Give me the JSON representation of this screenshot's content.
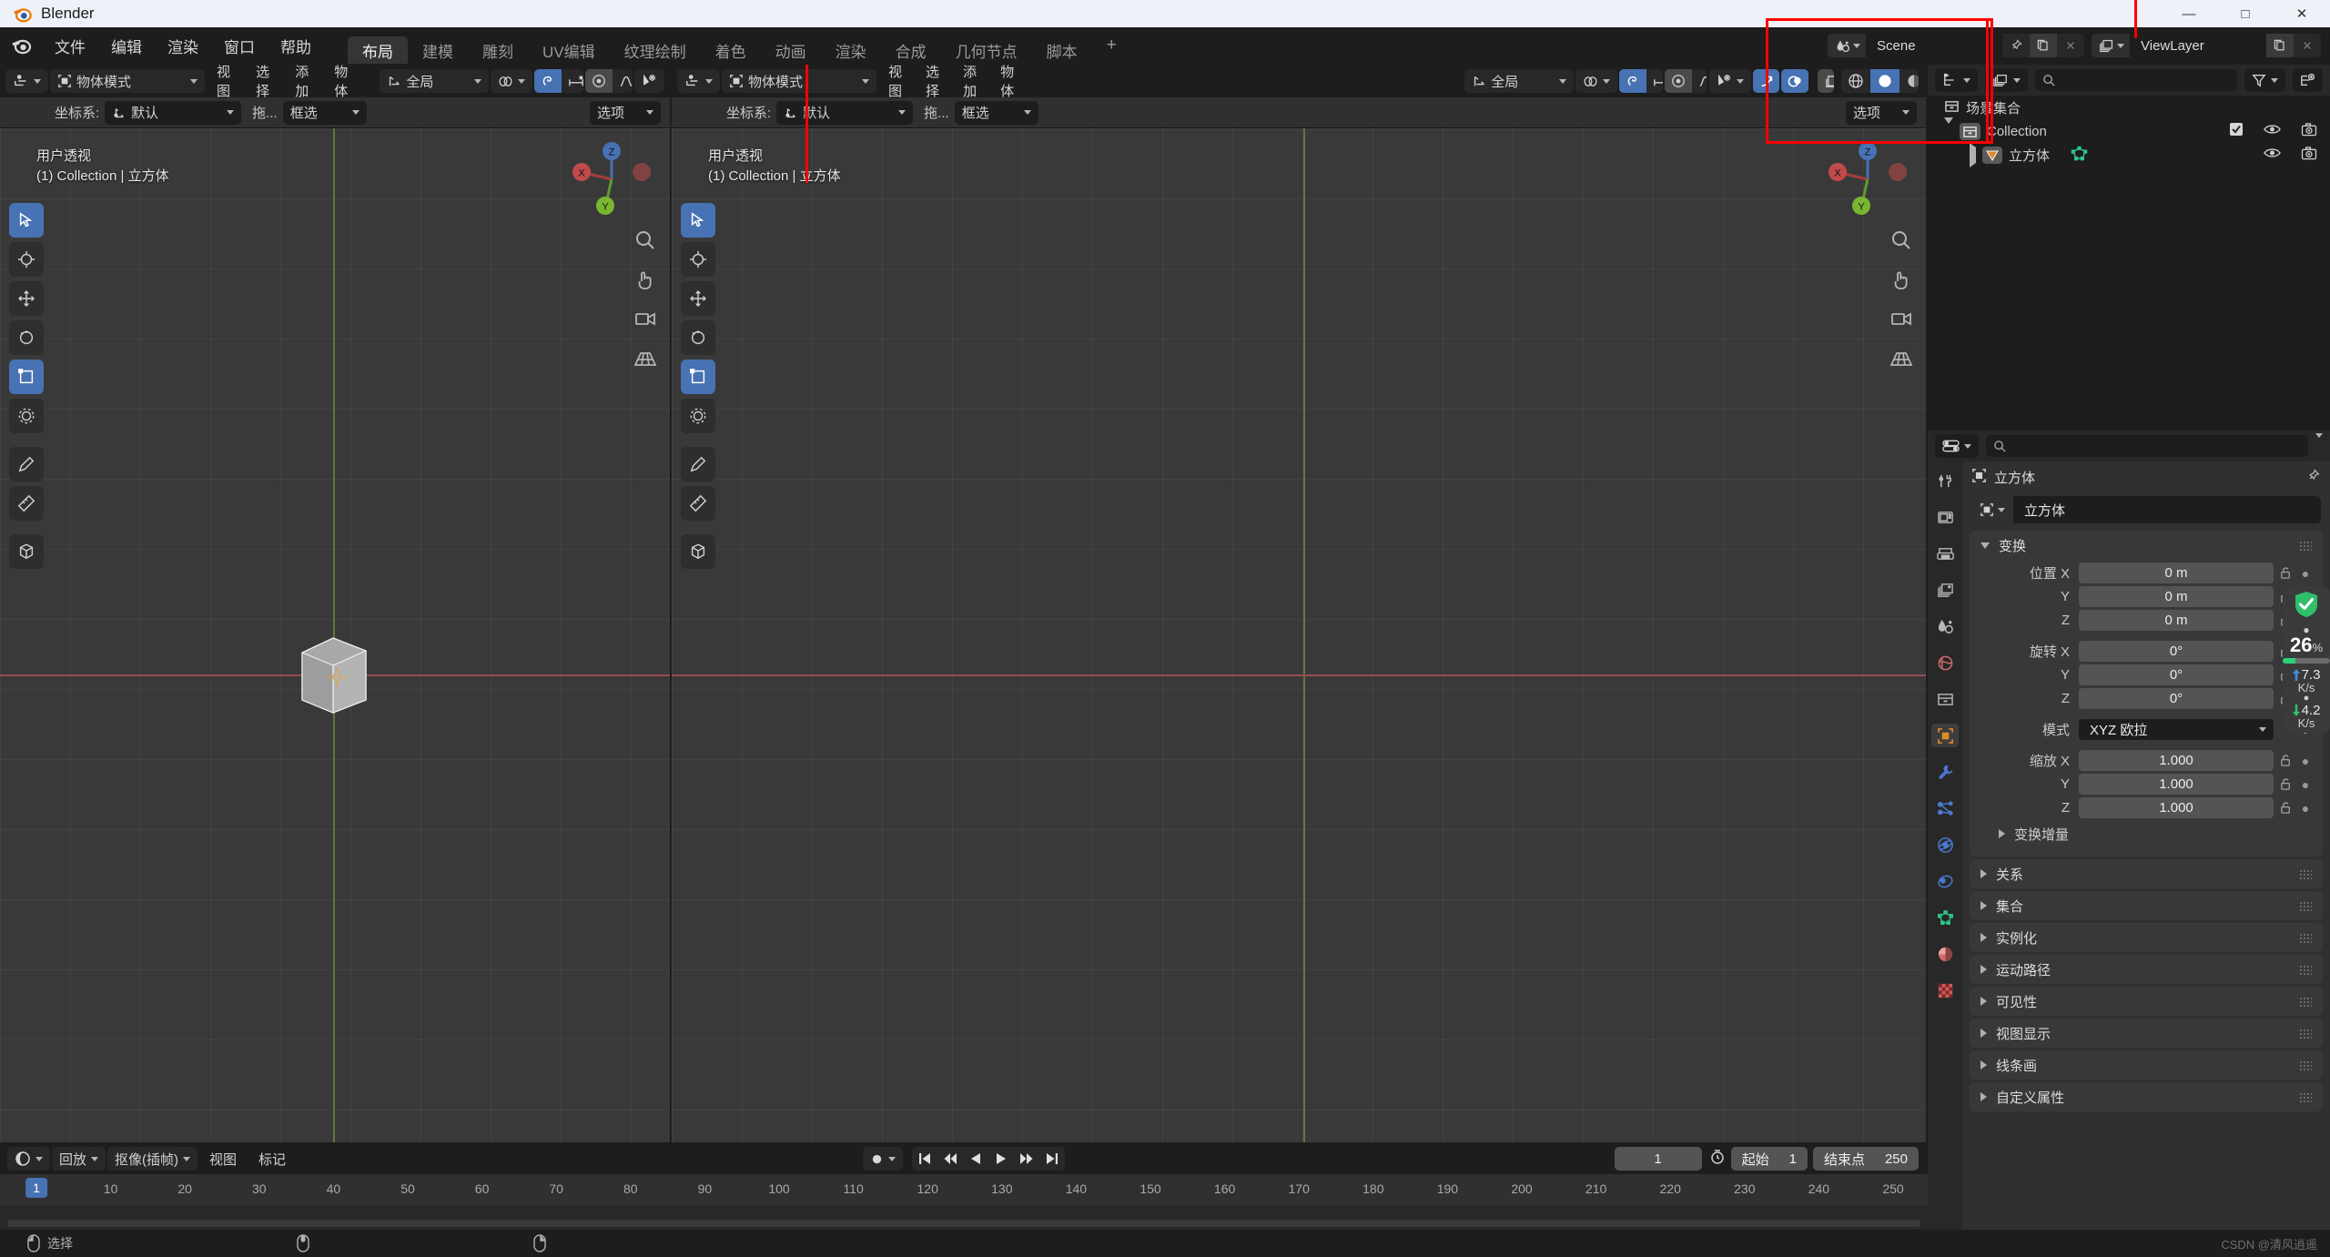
{
  "window": {
    "title": "Blender",
    "minimize": "—",
    "maximize": "□",
    "close": "✕"
  },
  "topbar": {
    "menus": [
      "文件",
      "编辑",
      "渲染",
      "窗口",
      "帮助"
    ],
    "workspaces": [
      {
        "label": "布局",
        "active": true
      },
      {
        "label": "建模",
        "active": false
      },
      {
        "label": "雕刻",
        "active": false
      },
      {
        "label": "UV编辑",
        "active": false
      },
      {
        "label": "纹理绘制",
        "active": false
      },
      {
        "label": "着色",
        "active": false
      },
      {
        "label": "动画",
        "active": false
      },
      {
        "label": "渲染",
        "active": false
      },
      {
        "label": "合成",
        "active": false
      },
      {
        "label": "几何节点",
        "active": false
      },
      {
        "label": "脚本",
        "active": false
      }
    ],
    "add_workspace": "+",
    "scene_name": "Scene",
    "viewlayer_name": "ViewLayer"
  },
  "viewport": {
    "mode": "物体模式",
    "menus": [
      "视图",
      "选择",
      "添加",
      "物体"
    ],
    "transform_orientation": "全局",
    "tool_settings": {
      "coord_label": "坐标系:",
      "coord_value": "默认",
      "drag_label": "拖...",
      "drag_value": "框选",
      "options_label": "选项"
    },
    "overlay_line1": "用户透视",
    "overlay_line2": "(1) Collection | 立方体",
    "gizmo_axes": {
      "x": "X",
      "y": "Y",
      "z": "Z"
    }
  },
  "outliner": {
    "display_mode_icon": "outliner-icon",
    "filter_icon": "filter-icon",
    "rows": [
      {
        "label": "场景集合",
        "indent": 0,
        "icon": "collection-icon",
        "has_disclosure": false,
        "checkbox": false,
        "eye": false,
        "camera": false
      },
      {
        "label": "Collection",
        "indent": 1,
        "icon": "collection-icon",
        "has_disclosure": true,
        "expanded": true,
        "checkbox": true,
        "eye": true,
        "camera": true
      },
      {
        "label": "立方体",
        "indent": 2,
        "icon": "mesh-object-icon",
        "has_disclosure": true,
        "expanded": false,
        "checkbox": false,
        "eye": true,
        "camera": true,
        "data_icon": "mesh-data-icon"
      }
    ]
  },
  "properties": {
    "breadcrumb_object": "立方体",
    "id_name": "立方体",
    "transform_panel": {
      "title": "变换",
      "location_label": "位置 X",
      "location": [
        "0 m",
        "0 m",
        "0 m"
      ],
      "rotation_label": "旋转 X",
      "rotation": [
        "0°",
        "0°",
        "0°"
      ],
      "mode_label": "模式",
      "mode_value": "XYZ 欧拉",
      "scale_label": "缩放 X",
      "scale": [
        "1.000",
        "1.000",
        "1.000"
      ],
      "axis_y": "Y",
      "axis_z": "Z",
      "delta_label": "变换增量"
    },
    "collapsed_panels": [
      "关系",
      "集合",
      "实例化",
      "运动路径",
      "可见性",
      "视图显示",
      "线条画",
      "自定义属性"
    ],
    "tabs": [
      {
        "name": "tool-tab",
        "color": "#b9b9b9",
        "active": false
      },
      {
        "name": "render-tab",
        "color": "#b9b9b9",
        "active": false
      },
      {
        "name": "output-tab",
        "color": "#b9b9b9",
        "active": false
      },
      {
        "name": "view-layer-tab",
        "color": "#b9b9b9",
        "active": false
      },
      {
        "name": "scene-tab",
        "color": "#b9b9b9",
        "active": false
      },
      {
        "name": "world-tab",
        "color": "#d06a6a",
        "active": false
      },
      {
        "name": "collection-tab",
        "color": "#b9b9b9",
        "active": false
      },
      {
        "name": "object-tab",
        "color": "#e08b2a",
        "active": true
      },
      {
        "name": "modifier-tab",
        "color": "#4a78d0",
        "active": false
      },
      {
        "name": "particles-tab",
        "color": "#4a78d0",
        "active": false
      },
      {
        "name": "physics-tab",
        "color": "#4a78d0",
        "active": false
      },
      {
        "name": "constraints-tab",
        "color": "#4a78d0",
        "active": false
      },
      {
        "name": "object-data-tab",
        "color": "#2ec48a",
        "active": false
      },
      {
        "name": "material-tab",
        "color": "#d06a6a",
        "active": false
      },
      {
        "name": "texture-tab",
        "color": "#d05a5a",
        "active": false
      }
    ]
  },
  "timeline": {
    "menus": [
      "回放",
      "抠像(插帧)",
      "视图",
      "标记"
    ],
    "current_frame": "1",
    "start_label": "起始",
    "start_value": "1",
    "end_label": "结束点",
    "end_value": "250",
    "ticks": [
      "1",
      "10",
      "20",
      "30",
      "40",
      "50",
      "60",
      "70",
      "80",
      "90",
      "100",
      "110",
      "120",
      "130",
      "140",
      "150",
      "160",
      "170",
      "180",
      "190",
      "200",
      "210",
      "220",
      "230",
      "240",
      "250"
    ],
    "playhead_frame": "1"
  },
  "statusbar": {
    "mouse_action": "选择",
    "watermark": "CSDN @清风逍遥"
  },
  "overlay_widget": {
    "percent": "26",
    "percent_unit": "%",
    "up_speed": "7.3",
    "up_unit": "K/s",
    "down_speed": "4.2",
    "down_unit": "K/s",
    "progress": 26
  },
  "annotation": {
    "color": "#ff0000"
  },
  "colors": {
    "accent_blue": "#4772b3",
    "object_orange": "#e08b2a",
    "mesh_green": "#2ec48a",
    "bg_dark": "#1d1d1d",
    "bg_mid": "#303030",
    "viewport": "#393939"
  }
}
